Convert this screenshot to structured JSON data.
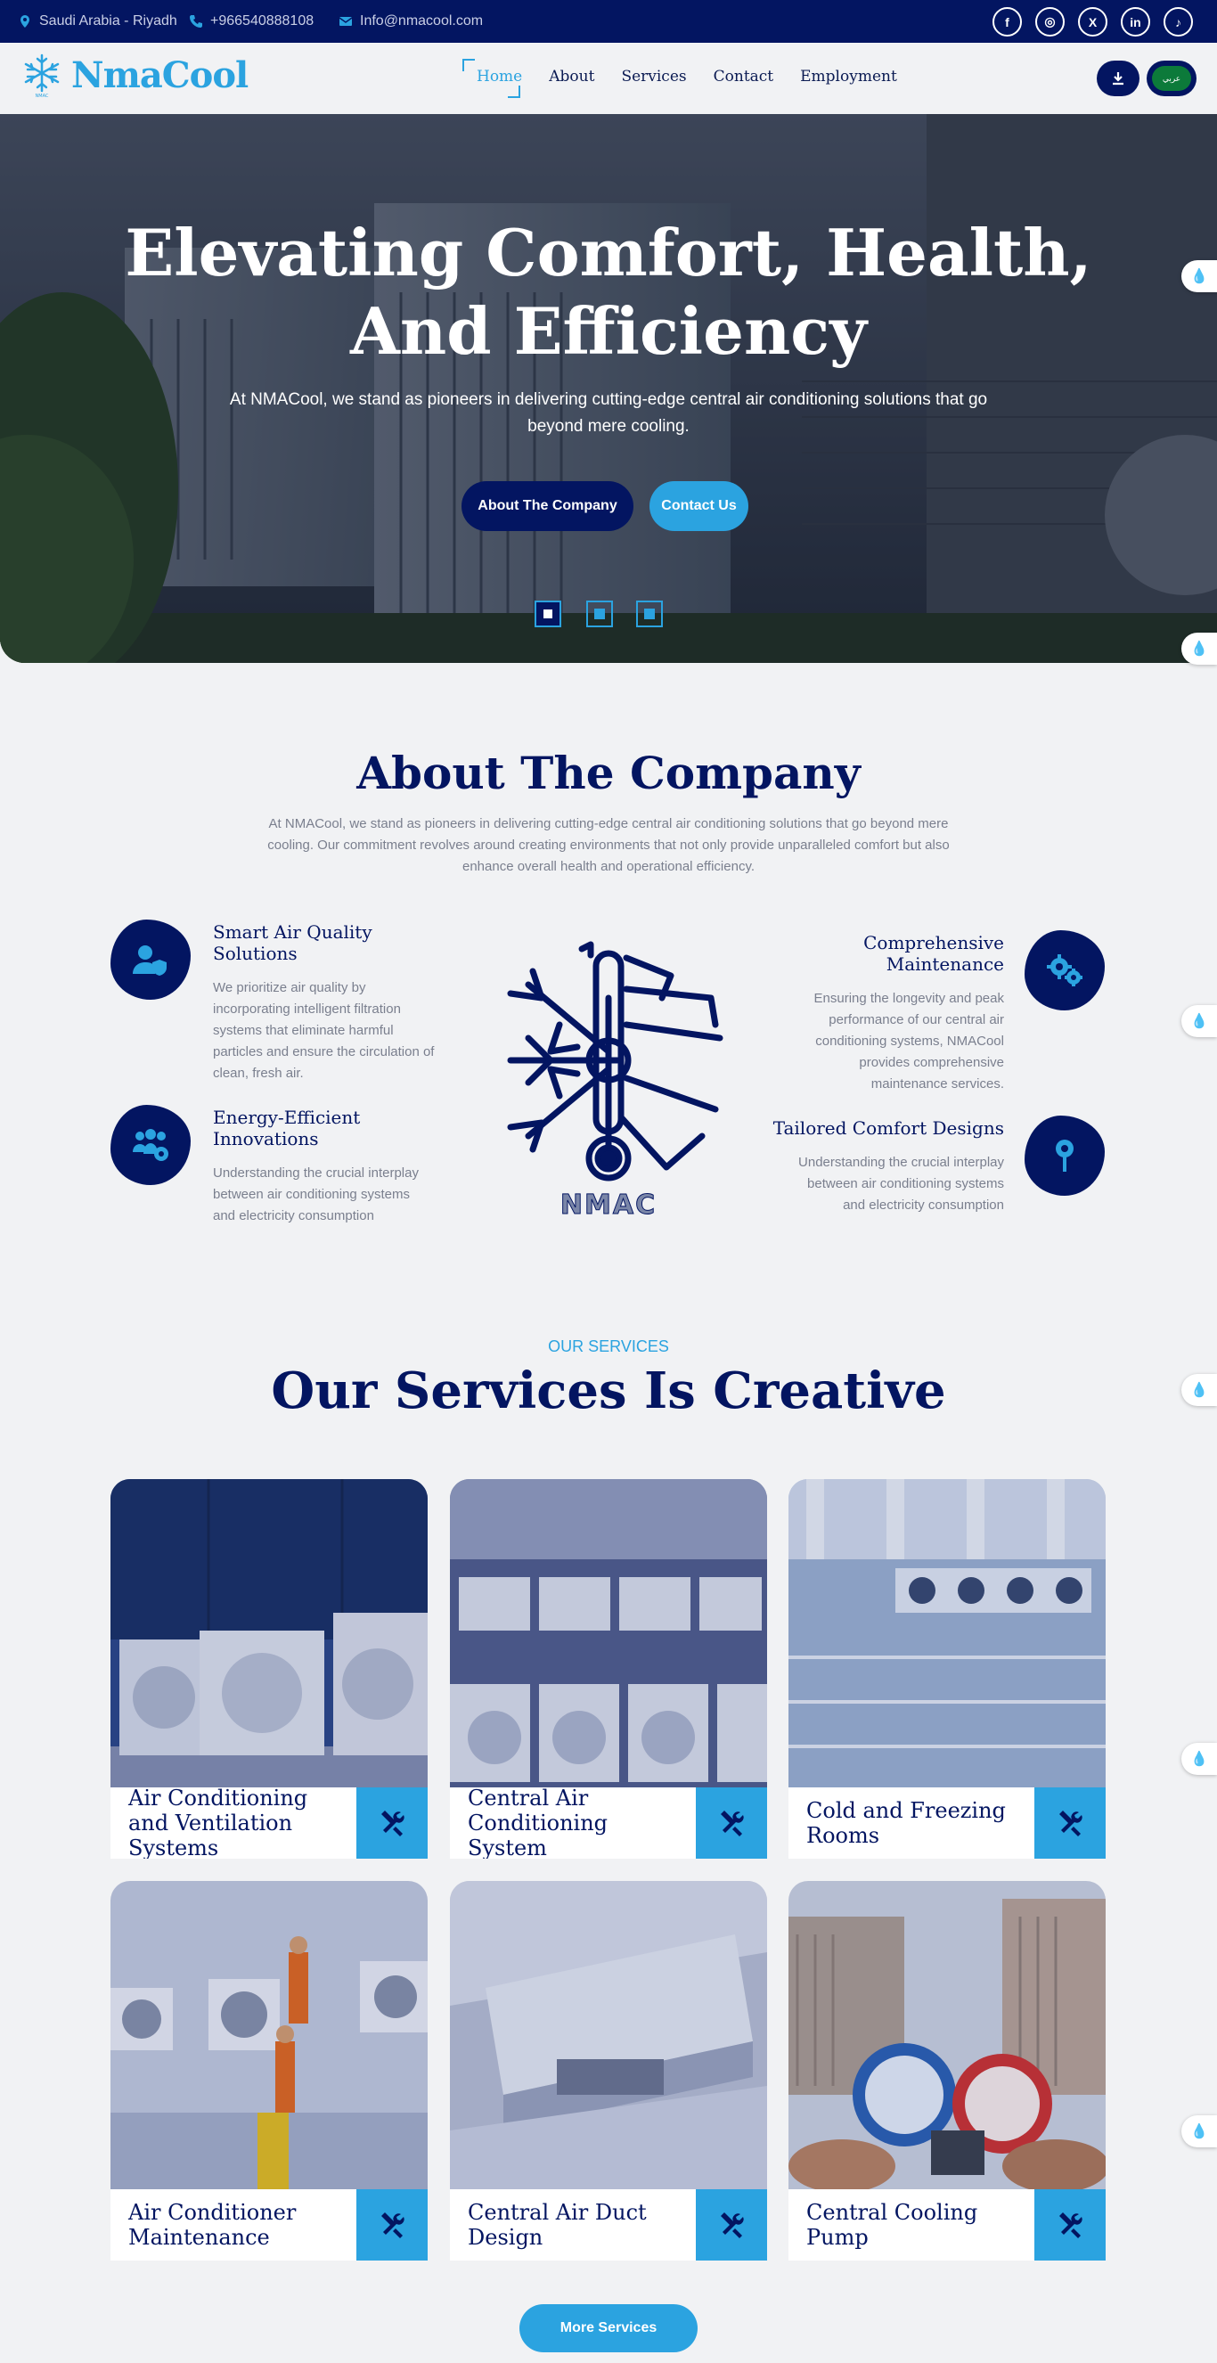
{
  "topbar": {
    "location": "Saudi Arabia - Riyadh",
    "phone": "+966540888108",
    "email": "Info@nmacool.com",
    "social": [
      "f",
      "◎",
      "X",
      "in",
      "♪"
    ]
  },
  "nav": {
    "logo_text": "NmaCool",
    "items": [
      "Home",
      "About",
      "Services",
      "Contact",
      "Employment"
    ],
    "lang_badge": "عربي"
  },
  "hero": {
    "title_line1": "Elevating Comfort, Health,",
    "title_line2": "And Efficiency",
    "subtitle": "At NMACool, we stand as pioneers in delivering cutting-edge central air conditioning solutions that go beyond mere cooling.",
    "btn_about": "About The Company",
    "btn_contact": "Contact Us"
  },
  "about": {
    "title": "About The Company",
    "intro": "At NMACool, we stand as pioneers in delivering cutting-edge central air conditioning solutions that go beyond mere cooling. Our commitment revolves around creating environments that not only provide unparalleled comfort but also enhance overall health and operational efficiency.",
    "logo_text": "NMAC",
    "features": [
      {
        "title": "Smart Air Quality Solutions",
        "text": "We prioritize air quality by incorporating intelligent filtration systems that eliminate harmful particles and ensure the circulation of clean, fresh air.",
        "icon": "user-shield-icon"
      },
      {
        "title": "Energy-Efficient Innovations",
        "text": "Understanding the crucial interplay between air conditioning systems and electricity consumption",
        "icon": "users-gear-icon"
      },
      {
        "title": "Comprehensive Maintenance",
        "text": "Ensuring the longevity and peak performance of our central air conditioning systems, NMACool provides comprehensive maintenance services.",
        "icon": "gears-icon"
      },
      {
        "title": "Tailored Comfort Designs",
        "text": "Understanding the crucial interplay between air conditioning systems and electricity consumption",
        "icon": "brush-icon"
      }
    ]
  },
  "services": {
    "kicker": "OUR SERVICES",
    "title": "Our Services Is Creative",
    "cards": [
      "Air Conditioning and Ventilation Systems",
      "Central Air Conditioning System",
      "Cold and Freezing Rooms",
      "Air Conditioner Maintenance",
      "Central Air Duct Design",
      "Central Cooling Pump"
    ],
    "more": "More Services"
  },
  "colors": {
    "navy": "#031561",
    "accent": "#2ba3e0"
  }
}
